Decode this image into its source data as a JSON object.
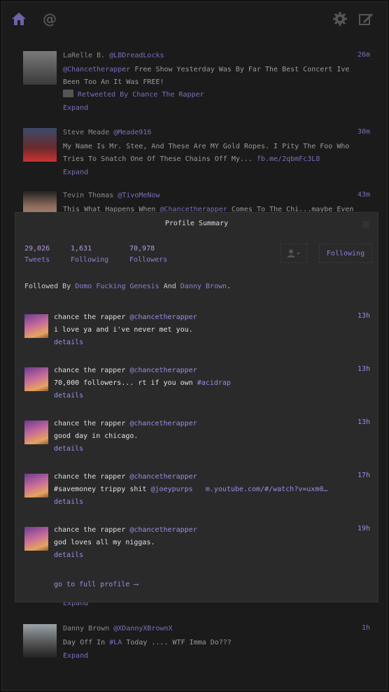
{
  "topbar": {
    "home_icon": "home-icon",
    "mentions_icon": "at-icon",
    "mentions_glyph": "@",
    "settings_icon": "gear-icon",
    "compose_icon": "compose-icon"
  },
  "feed": [
    {
      "name": "LaRelle B.",
      "handle": "@LBDreadLocks",
      "time": "26m",
      "text_prefix": "@Chancetherapper",
      "text_line1_rest": " Free Show Yesterday Was By Far The Best Concert Ive",
      "text_line2": "Been Too An It Was FREE!",
      "retweet": "Retweeted By Chance The Rapper",
      "expand": "Expand"
    },
    {
      "name": "Steve Meade",
      "handle": "@Meade916",
      "time": "30m",
      "text_line1": "My Name Is Mr. Stee, And These Are MY Gold Ropes. I Pity The Foo Who",
      "text_line2": "Tries To Snatch One Of These Chains Off My... ",
      "link": "fb.me/2qbmFc3L8",
      "expand": "Expand"
    },
    {
      "name": "Tevin Thomas",
      "handle": "@TivoMeNow",
      "time": "43m",
      "text_a": "This What Happens When ",
      "text_link": "@Chancetherapper",
      "text_b": " Comes To The Chi...maybe Even"
    },
    {
      "expand": "Expand"
    },
    {
      "name": "Danny Brown",
      "handle": "@XDannyXBrownX",
      "time": "1h",
      "text_a": "Day Off In ",
      "text_link": "#LA",
      "text_b": " Today .... WTF Imma Do???",
      "expand": "Expand"
    }
  ],
  "panel": {
    "title": "Profile Summary",
    "stats": [
      {
        "num": "29,026",
        "label": "Tweets"
      },
      {
        "num": "1,631",
        "label": "Following"
      },
      {
        "num": "70,978",
        "label": "Followers"
      }
    ],
    "follow_label": "Following",
    "followed_by_prefix": "Followed By ",
    "followed_by_1": "Domo Fucking Genesis",
    "followed_by_and": " And ",
    "followed_by_2": "Danny Brown",
    "followed_by_end": ".",
    "tweets": [
      {
        "name": "chance the rapper ",
        "handle": "@chancetherapper",
        "time": "13h",
        "text_a": "i love ya and i've never met you.",
        "text_link": "",
        "text_b": "",
        "details": "details"
      },
      {
        "name": "chance the rapper ",
        "handle": "@chancetherapper",
        "time": "13h",
        "text_a": "70,000 followers... rt if you own ",
        "text_link": "#acidrap",
        "text_b": "",
        "details": "details"
      },
      {
        "name": "chance the rapper ",
        "handle": "@chancetherapper",
        "time": "13h",
        "text_a": "good day in chicago.",
        "text_link": "",
        "text_b": "",
        "details": "details"
      },
      {
        "name": "chance the rapper ",
        "handle": "@chancetherapper",
        "time": "17h",
        "text_a": "#savemoney trippy shit ",
        "text_link": "@joeypurps",
        "text_b": "   m.youtube.com/#/watch?v=uxm0…",
        "details": "details"
      },
      {
        "name": "chance the rapper ",
        "handle": "@chancetherapper",
        "time": "19h",
        "text_a": "god loves all my niggas.",
        "text_link": "",
        "text_b": "",
        "details": "details"
      }
    ],
    "full_profile": "go to full profile ⟶"
  },
  "colors": {
    "accent": "#8b80d6",
    "background": "#1b1b1b",
    "panel": "#2a2a2a"
  }
}
